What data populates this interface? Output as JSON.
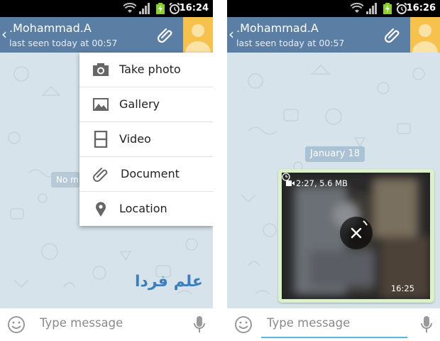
{
  "left": {
    "status": {
      "time": "16:24"
    },
    "header": {
      "name": ".Mohammad.A",
      "last_seen": "last seen today at 00:57"
    },
    "menu": [
      {
        "label": "Take photo",
        "icon": "camera-icon"
      },
      {
        "label": "Gallery",
        "icon": "gallery-icon"
      },
      {
        "label": "Video",
        "icon": "video-icon"
      },
      {
        "label": "Document",
        "icon": "document-icon"
      },
      {
        "label": "Location",
        "icon": "location-icon"
      }
    ],
    "no_messages_partial": "No m",
    "watermark": "علم فردا",
    "input": {
      "placeholder": "Type message"
    }
  },
  "right": {
    "status": {
      "time": "16:26"
    },
    "header": {
      "name": ".Mohammad.A",
      "last_seen": "last seen today at 00:57"
    },
    "date_badge": "January 18",
    "video": {
      "info": "2:27, 5.6 MB",
      "time": "16:25"
    },
    "input": {
      "placeholder": "Type message"
    }
  },
  "colors": {
    "header": "#5b7ea5",
    "chat_background": "#d6e3ea",
    "bubble_outgoing": "#dbf1c8",
    "accent": "#5bb7d8",
    "avatar": "#f6c24b"
  }
}
